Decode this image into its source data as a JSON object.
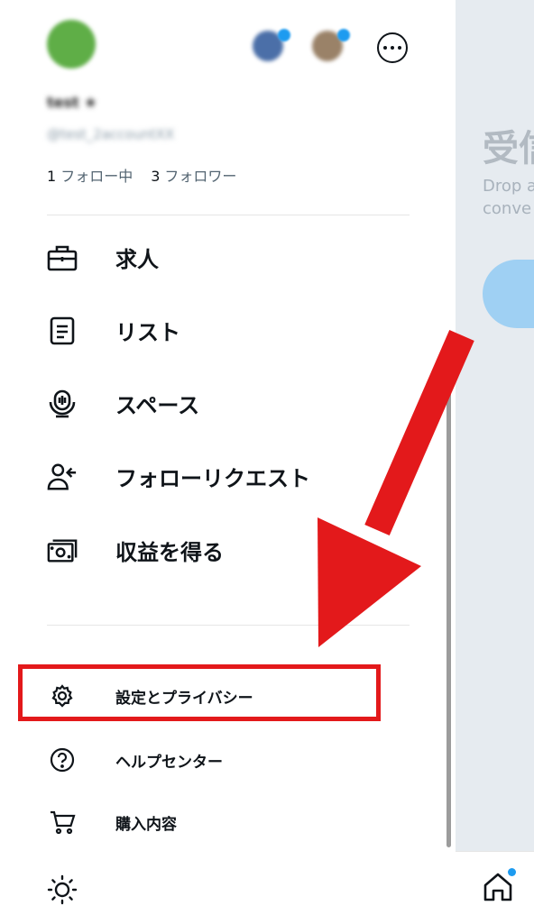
{
  "profile": {
    "name": "test ★",
    "handle": "@test_2accountXX",
    "following_count": "1",
    "following_label": "フォロー中",
    "followers_count": "3",
    "followers_label": "フォロワー"
  },
  "menu_primary": [
    {
      "label": "求人",
      "icon": "briefcase-icon"
    },
    {
      "label": "リスト",
      "icon": "list-icon"
    },
    {
      "label": "スペース",
      "icon": "spaces-microphone-icon"
    },
    {
      "label": "フォローリクエスト",
      "icon": "person-add-icon"
    },
    {
      "label": "収益を得る",
      "icon": "money-icon"
    }
  ],
  "menu_secondary": [
    {
      "label": "設定とプライバシー",
      "icon": "gear-icon"
    },
    {
      "label": "ヘルプセンター",
      "icon": "help-icon"
    },
    {
      "label": "購入内容",
      "icon": "cart-icon"
    }
  ],
  "right_pane": {
    "title": "受信",
    "description_line1": "Drop a",
    "description_line2": "conve"
  },
  "colors": {
    "highlight": "#e3191b",
    "accent": "#1d9bf0"
  }
}
